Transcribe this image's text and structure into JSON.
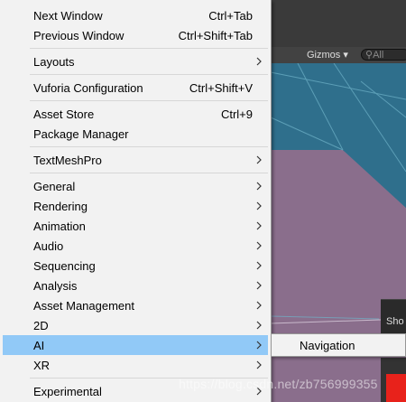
{
  "scene": {
    "gizmos_label": "Gizmos ▾",
    "search_placeholder": "All",
    "panel_label": "Sho",
    "watermark": "https://blog.csdn.net/zb756999355",
    "colors": {
      "ground": "#8a6e8c",
      "sky": "#2d6e8a",
      "toolbar": "#3a3a3a"
    }
  },
  "menu": {
    "items": [
      {
        "label": "Next Window",
        "shortcut": "Ctrl+Tab"
      },
      {
        "label": "Previous Window",
        "shortcut": "Ctrl+Shift+Tab"
      },
      {
        "label": "Layouts"
      },
      {
        "label": "Vuforia Configuration",
        "shortcut": "Ctrl+Shift+V"
      },
      {
        "label": "Asset Store",
        "shortcut": "Ctrl+9"
      },
      {
        "label": "Package Manager"
      },
      {
        "label": "TextMeshPro"
      },
      {
        "label": "General"
      },
      {
        "label": "Rendering"
      },
      {
        "label": "Animation"
      },
      {
        "label": "Audio"
      },
      {
        "label": "Sequencing"
      },
      {
        "label": "Analysis"
      },
      {
        "label": "Asset Management"
      },
      {
        "label": "2D"
      },
      {
        "label": "AI"
      },
      {
        "label": "XR"
      },
      {
        "label": "Experimental"
      }
    ],
    "highlighted": "AI",
    "highlight_color": "#91c9f7"
  },
  "submenu": {
    "items": [
      {
        "label": "Navigation"
      }
    ]
  }
}
